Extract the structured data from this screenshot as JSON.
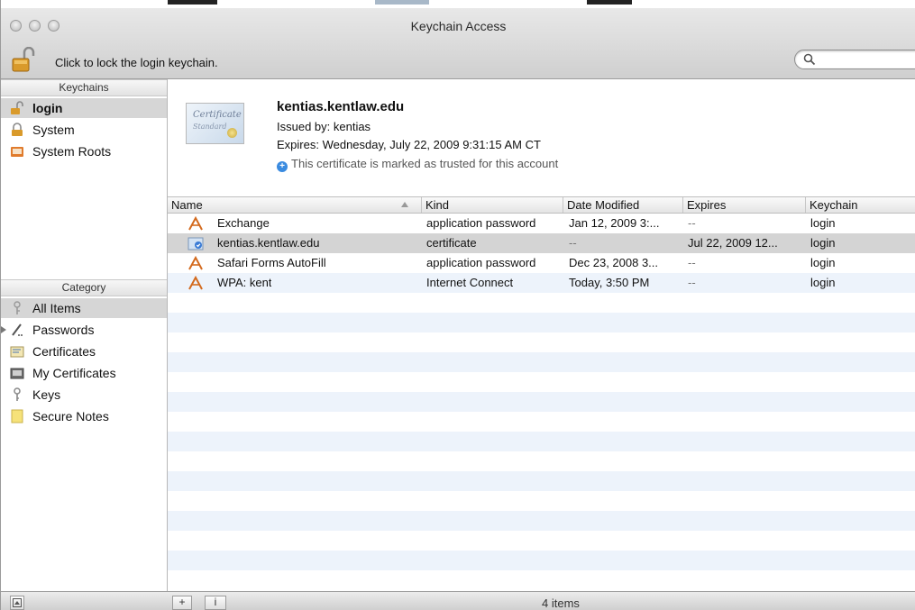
{
  "window": {
    "title": "Keychain Access"
  },
  "toolbar": {
    "lock_message": "Click to lock the login keychain.",
    "search_placeholder": ""
  },
  "sidebar": {
    "keychains_header": "Keychains",
    "keychains": [
      {
        "label": "login",
        "icon": "open-lock-icon",
        "selected": true
      },
      {
        "label": "System",
        "icon": "lock-icon",
        "selected": false
      },
      {
        "label": "System Roots",
        "icon": "folder-cabinet-icon",
        "selected": false
      }
    ],
    "category_header": "Category",
    "categories": [
      {
        "label": "All Items",
        "icon": "all-items-icon",
        "selected": true
      },
      {
        "label": "Passwords",
        "icon": "pen-icon",
        "selected": false
      },
      {
        "label": "Certificates",
        "icon": "certificate-icon",
        "selected": false
      },
      {
        "label": "My Certificates",
        "icon": "my-certificate-icon",
        "selected": false
      },
      {
        "label": "Keys",
        "icon": "key-icon",
        "selected": false
      },
      {
        "label": "Secure Notes",
        "icon": "note-icon",
        "selected": false
      }
    ]
  },
  "detail": {
    "cert_image_line1": "Certificate",
    "cert_image_line2": "Standard",
    "name": "kentias.kentlaw.edu",
    "issued_by": "Issued by: kentias",
    "expires": "Expires: Wednesday, July 22, 2009 9:31:15 AM CT",
    "trust": "This certificate is marked as trusted for this account"
  },
  "table": {
    "columns": [
      "Name",
      "Kind",
      "Date Modified",
      "Expires",
      "Keychain"
    ],
    "rows": [
      {
        "name": "Exchange",
        "kind": "application password",
        "date_modified": "Jan 12, 2009 3:...",
        "expires": "--",
        "keychain": "login",
        "icon": "password-icon"
      },
      {
        "name": "kentias.kentlaw.edu",
        "kind": "certificate",
        "date_modified": "--",
        "expires": "Jul 22, 2009 12...",
        "keychain": "login",
        "icon": "certificate-icon"
      },
      {
        "name": "Safari Forms AutoFill",
        "kind": "application password",
        "date_modified": "Dec 23, 2008 3...",
        "expires": "--",
        "keychain": "login",
        "icon": "password-icon"
      },
      {
        "name": "WPA: kent",
        "kind": "Internet Connect",
        "date_modified": "Today, 3:50 PM",
        "expires": "--",
        "keychain": "login",
        "icon": "password-icon"
      }
    ]
  },
  "bottom": {
    "add_label": "+",
    "info_label": "i",
    "item_count": "4 items"
  },
  "colors": {
    "row_alt": "#edf3fb",
    "selection": "#d4d4d4",
    "trust_icon": "#3a8be0"
  }
}
